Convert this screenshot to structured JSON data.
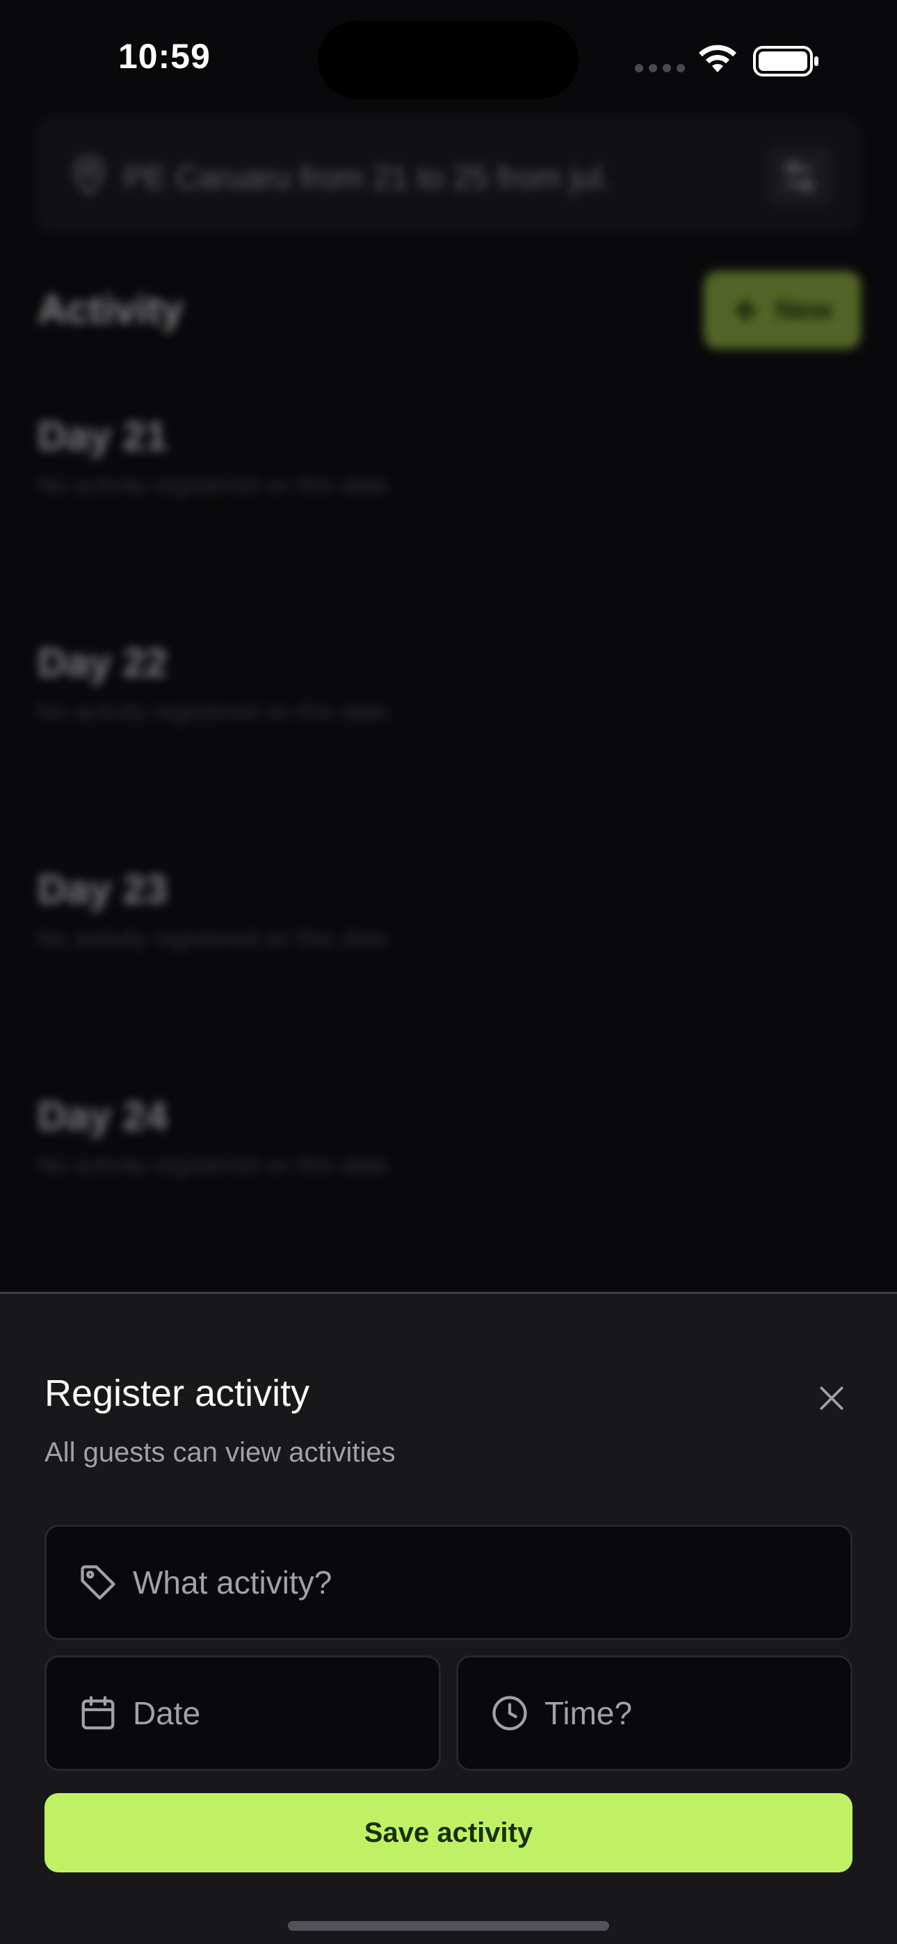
{
  "status_bar": {
    "time": "10:59",
    "wifi_icon": "wifi-icon",
    "battery_icon": "battery-icon"
  },
  "background": {
    "search": {
      "icon": "map-pin-icon",
      "text": "PE Caruaru from 21 to 25 from jul.",
      "settings_icon": "settings-sliders-icon"
    },
    "activity_title": "Activity",
    "new_button": {
      "icon": "plus-icon",
      "label": "New"
    },
    "days": [
      {
        "title": "Day 21",
        "subtitle": "No activity registered on this date."
      },
      {
        "title": "Day 22",
        "subtitle": "No activity registered on this date."
      },
      {
        "title": "Day 23",
        "subtitle": "No activity registered on this date."
      },
      {
        "title": "Day 24",
        "subtitle": "No activity registered on this date."
      }
    ]
  },
  "sheet": {
    "title": "Register activity",
    "subtitle": "All guests can view activities",
    "close_icon": "close-icon",
    "activity_field": {
      "icon": "tag-icon",
      "placeholder": "What activity?",
      "value": ""
    },
    "date_field": {
      "icon": "calendar-icon",
      "placeholder": "Date",
      "value": ""
    },
    "time_field": {
      "icon": "clock-icon",
      "placeholder": "Time?",
      "value": ""
    },
    "save_label": "Save activity"
  },
  "colors": {
    "background": "#09090b",
    "sheet": "#18181b",
    "accent": "#bef264",
    "accent_text": "#1a2e05",
    "muted_text": "#a1a1aa"
  }
}
